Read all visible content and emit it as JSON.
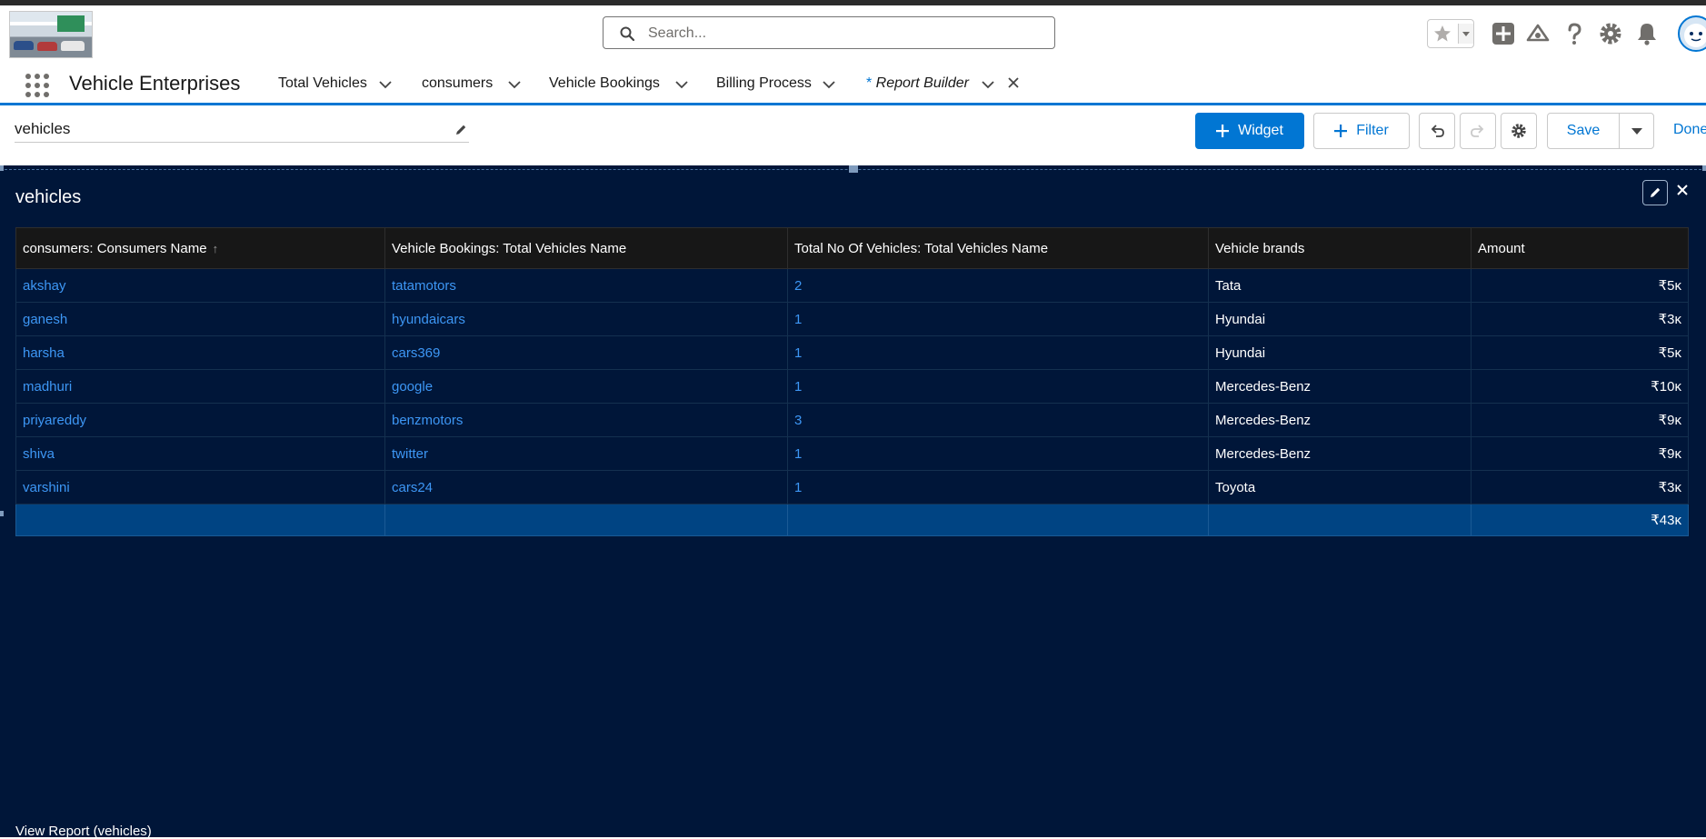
{
  "header": {
    "search_placeholder": "Search...",
    "icons": [
      "star-icon",
      "add-icon",
      "trailhead-icon",
      "help-icon",
      "setup-gear-icon",
      "notification-bell-icon",
      "avatar"
    ]
  },
  "nav": {
    "app_name": "Vehicle Enterprises",
    "tabs": [
      {
        "label": "Total Vehicles"
      },
      {
        "label": "consumers"
      },
      {
        "label": "Vehicle Bookings"
      },
      {
        "label": "Billing Process"
      },
      {
        "label": "Report Builder",
        "prefix": "* ",
        "active": true
      }
    ]
  },
  "toolbar": {
    "dashboard_name": "vehicles",
    "widget_label": "Widget",
    "filter_label": "Filter",
    "save_label": "Save",
    "done_label": "Done"
  },
  "widget": {
    "title": "vehicles",
    "columns": [
      "consumers: Consumers Name",
      "Vehicle Bookings: Total Vehicles Name",
      "Total No Of Vehicles: Total Vehicles Name",
      "Vehicle brands",
      "Amount"
    ],
    "sort_indicator": "↑",
    "rows": [
      {
        "consumer": "akshay",
        "booking": "tatamotors",
        "count": "2",
        "brand": "Tata",
        "amount": "₹5ĸ"
      },
      {
        "consumer": "ganesh",
        "booking": "hyundaicars",
        "count": "1",
        "brand": "Hyundai",
        "amount": "₹3ĸ"
      },
      {
        "consumer": "harsha",
        "booking": "cars369",
        "count": "1",
        "brand": "Hyundai",
        "amount": "₹5ĸ"
      },
      {
        "consumer": "madhuri",
        "booking": "google",
        "count": "1",
        "brand": "Mercedes-Benz",
        "amount": "₹10ĸ"
      },
      {
        "consumer": "priyareddy",
        "booking": "benzmotors",
        "count": "3",
        "brand": "Mercedes-Benz",
        "amount": "₹9ĸ"
      },
      {
        "consumer": "shiva",
        "booking": "twitter",
        "count": "1",
        "brand": "Mercedes-Benz",
        "amount": "₹9ĸ"
      },
      {
        "consumer": "varshini",
        "booking": "cars24",
        "count": "1",
        "brand": "Toyota",
        "amount": "₹3ĸ"
      }
    ],
    "total_amount": "₹43ĸ",
    "footer_link": "View Report (vehicles)"
  },
  "colors": {
    "brand_blue": "#0176d3",
    "canvas_bg": "#001639",
    "header_row_bg": "#171717",
    "total_row_bg": "#004483",
    "link_blue": "#3d97f5"
  }
}
